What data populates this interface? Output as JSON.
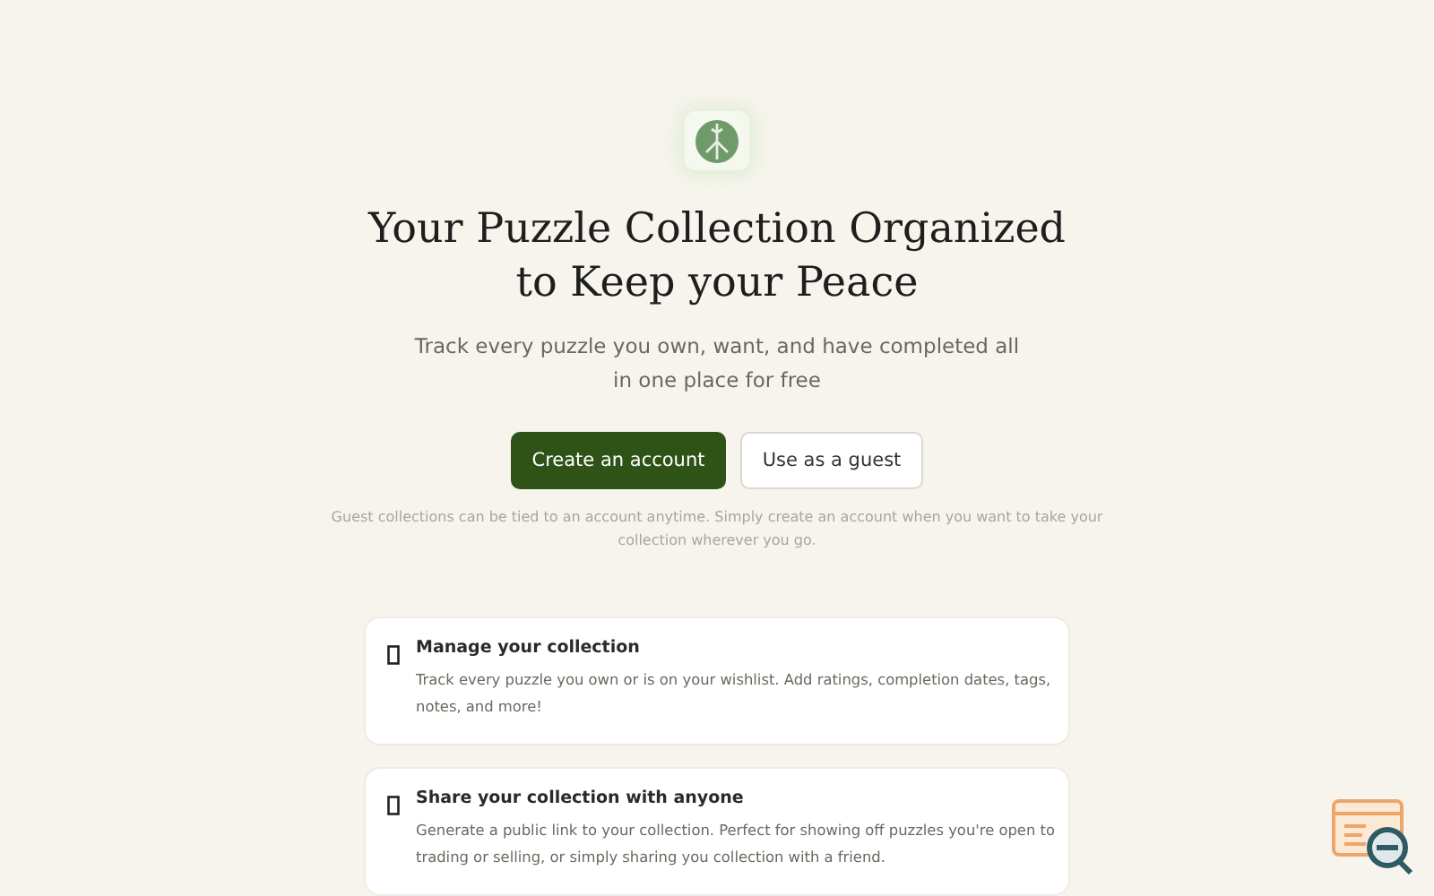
{
  "hero": {
    "title_lines": [
      "Your Puzzle Collection Organized",
      "to Keep your Peace"
    ],
    "subtitle_lines": [
      "Track every puzzle you own, want, and have completed all",
      "in one place for free"
    ]
  },
  "buttons": [
    {
      "label": "Create an account",
      "kind": "primary"
    },
    {
      "label": "Use as a guest",
      "kind": "secondary"
    }
  ],
  "note_lines": [
    "Guest collections can be tied to an account anytime. Simply create an account when you want to take your",
    "collection wherever you go."
  ],
  "features": [
    {
      "title": "Manage your collection",
      "text_lines": [
        "Track every puzzle you own or is on your wishlist. Add ratings, completion dates, tags,",
        "notes, and more!"
      ]
    },
    {
      "title": "Share your collection with anyone",
      "text_lines": [
        "Generate a public link to your collection. Perfect for showing off puzzles you're open to",
        "trading or selling, or simply sharing you collection with a friend."
      ]
    }
  ]
}
